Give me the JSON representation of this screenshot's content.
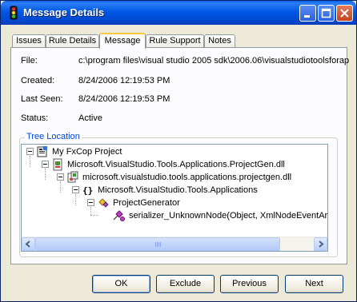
{
  "window": {
    "title": "Message Details",
    "colors": {
      "titlebar": "#0058e6",
      "face": "#ece9d8",
      "tab_highlight": "#ffc83c",
      "group_caption": "#0046d5"
    },
    "controls": [
      "minimize-icon",
      "maximize-icon",
      "close-icon"
    ]
  },
  "tabs": [
    {
      "label": "Issues"
    },
    {
      "label": "Rule Details"
    },
    {
      "label": "Message",
      "active": true
    },
    {
      "label": "Rule Support"
    },
    {
      "label": "Notes"
    }
  ],
  "details": {
    "file_label": "File:",
    "file_value": "c:\\program files\\visual studio 2005 sdk\\2006.06\\visualstudiotoolsforap",
    "created_label": "Created:",
    "created_value": "8/24/2006 12:19:53 PM",
    "last_seen_label": "Last Seen:",
    "last_seen_value": "8/24/2006 12:19:53 PM",
    "status_label": "Status:",
    "status_value": "Active"
  },
  "tree": {
    "caption": "Tree Location",
    "nodes": [
      {
        "label": "My FxCop Project",
        "icon": "project-icon"
      },
      {
        "label": "Microsoft.VisualStudio.Tools.Applications.ProjectGen.dll",
        "icon": "target-icon"
      },
      {
        "label": "microsoft.visualstudio.tools.applications.projectgen.dll",
        "icon": "module-icon"
      },
      {
        "label": "Microsoft.VisualStudio.Tools.Applications",
        "icon": "namespace-icon"
      },
      {
        "label": "ProjectGenerator",
        "icon": "class-icon"
      },
      {
        "label": "serializer_UnknownNode(Object, XmlNodeEventArgs",
        "icon": "method-icon"
      }
    ]
  },
  "buttons": {
    "ok": "OK",
    "exclude": "Exclude",
    "previous": "Previous",
    "next": "Next"
  }
}
